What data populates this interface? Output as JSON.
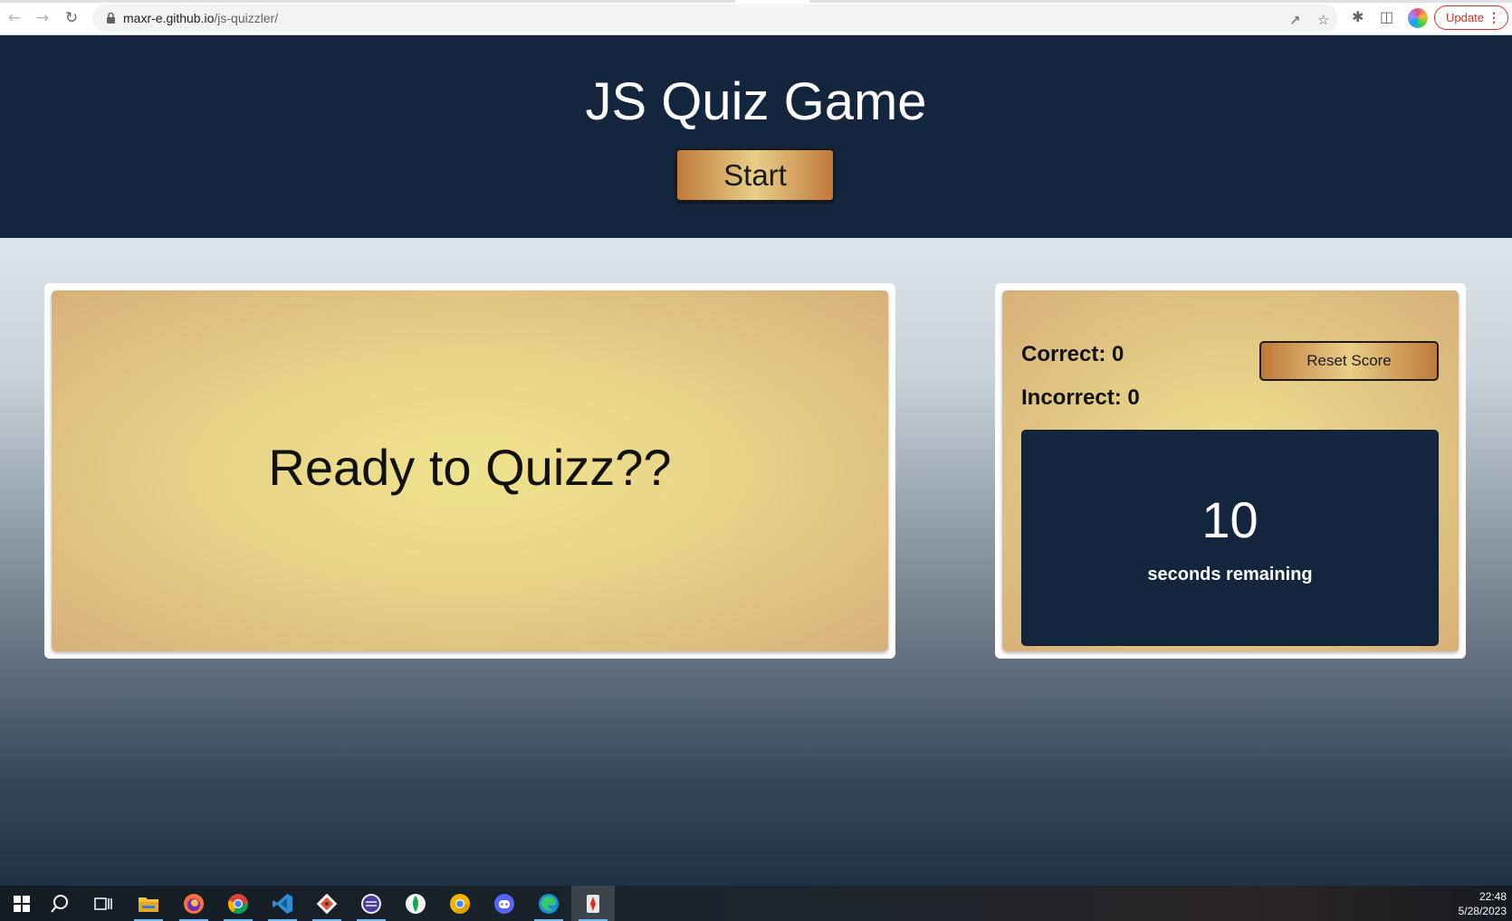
{
  "browser": {
    "url_host": "maxr-e.github.io",
    "url_path": "/js-quizzler/",
    "update_label": "Update"
  },
  "header": {
    "title": "JS Quiz Game",
    "start_label": "Start"
  },
  "quiz": {
    "prompt": "Ready to Quizz??"
  },
  "score": {
    "correct_label": "Correct: 0",
    "incorrect_label": "Incorrect: 0",
    "reset_label": "Reset Score",
    "timer_value": "10",
    "timer_label": "seconds remaining"
  },
  "taskbar": {
    "apps": [
      "start-icon",
      "search-icon",
      "task-view-icon",
      "file-explorer-icon",
      "firefox-icon",
      "chrome-icon",
      "vscode-icon",
      "git-icon",
      "eclipse-icon",
      "mongodb-compass-icon",
      "chrome-canary-icon",
      "discord-icon",
      "edge-icon",
      "app-icon"
    ],
    "time": "22:48",
    "date": "5/28/2023"
  },
  "colors": {
    "header_bg": "#14263e",
    "accent_gold": "#e8cf88",
    "accent_copper": "#c0793a"
  }
}
